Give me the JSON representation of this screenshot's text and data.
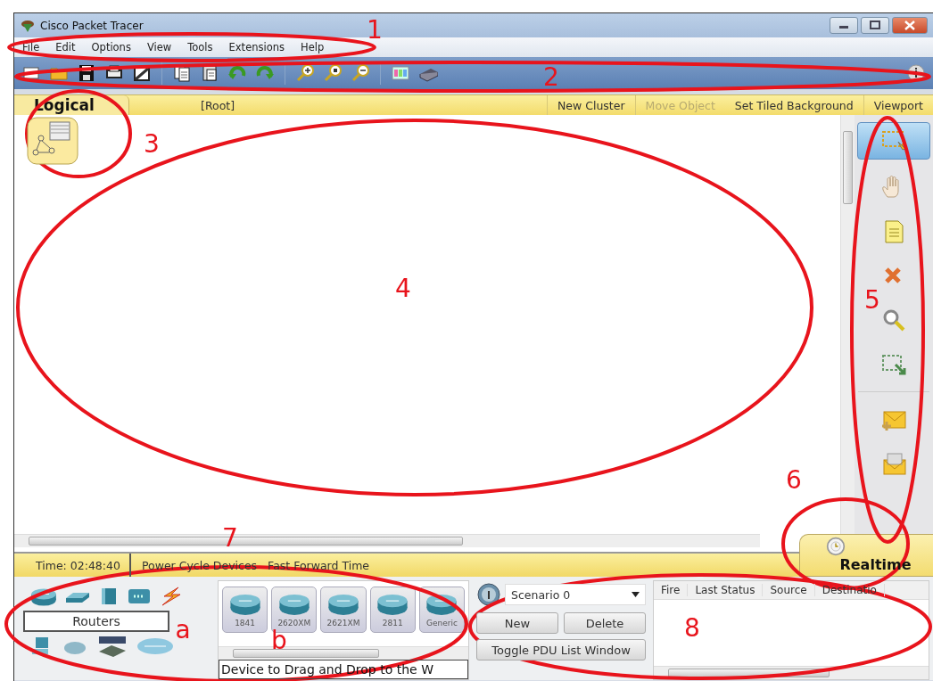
{
  "window": {
    "title": "Cisco Packet Tracer"
  },
  "menu": [
    "File",
    "Edit",
    "Options",
    "View",
    "Tools",
    "Extensions",
    "Help"
  ],
  "workspace_bar": {
    "mode": "Logical",
    "path": "[Root]",
    "actions": [
      {
        "label": "New Cluster",
        "disabled": false
      },
      {
        "label": "Move Object",
        "disabled": true
      },
      {
        "label": "Set Tiled Background",
        "disabled": false
      },
      {
        "label": "Viewport",
        "disabled": false
      }
    ]
  },
  "tools": [
    {
      "kind": "select",
      "selected": true
    },
    {
      "kind": "move",
      "selected": false
    },
    {
      "kind": "note",
      "selected": false
    },
    {
      "kind": "delete",
      "selected": false
    },
    {
      "kind": "inspect",
      "selected": false
    },
    {
      "kind": "resize",
      "selected": false
    },
    {
      "kind": "simple-pdu",
      "selected": false
    },
    {
      "kind": "complex-pdu",
      "selected": false
    }
  ],
  "status_bar": {
    "time": "Time: 02:48:40",
    "actions": [
      "Power Cycle Devices",
      "Fast Forward Time"
    ],
    "mode": "Realtime"
  },
  "device_types": {
    "category": "Routers"
  },
  "devices": [
    "1841",
    "2620XM",
    "2621XM",
    "2811",
    "Generic"
  ],
  "device_hint": "Device to Drag and Drop to the W",
  "scenario": {
    "value": "Scenario 0",
    "buttons": [
      "New",
      "Delete"
    ],
    "toggle": "Toggle PDU List Window"
  },
  "pdu_table": {
    "columns": [
      "Fire",
      "Last Status",
      "Source",
      "Destinatio"
    ]
  },
  "annotations": [
    "1",
    "2",
    "3",
    "4",
    "5",
    "6",
    "7",
    "a",
    "b",
    "8"
  ]
}
